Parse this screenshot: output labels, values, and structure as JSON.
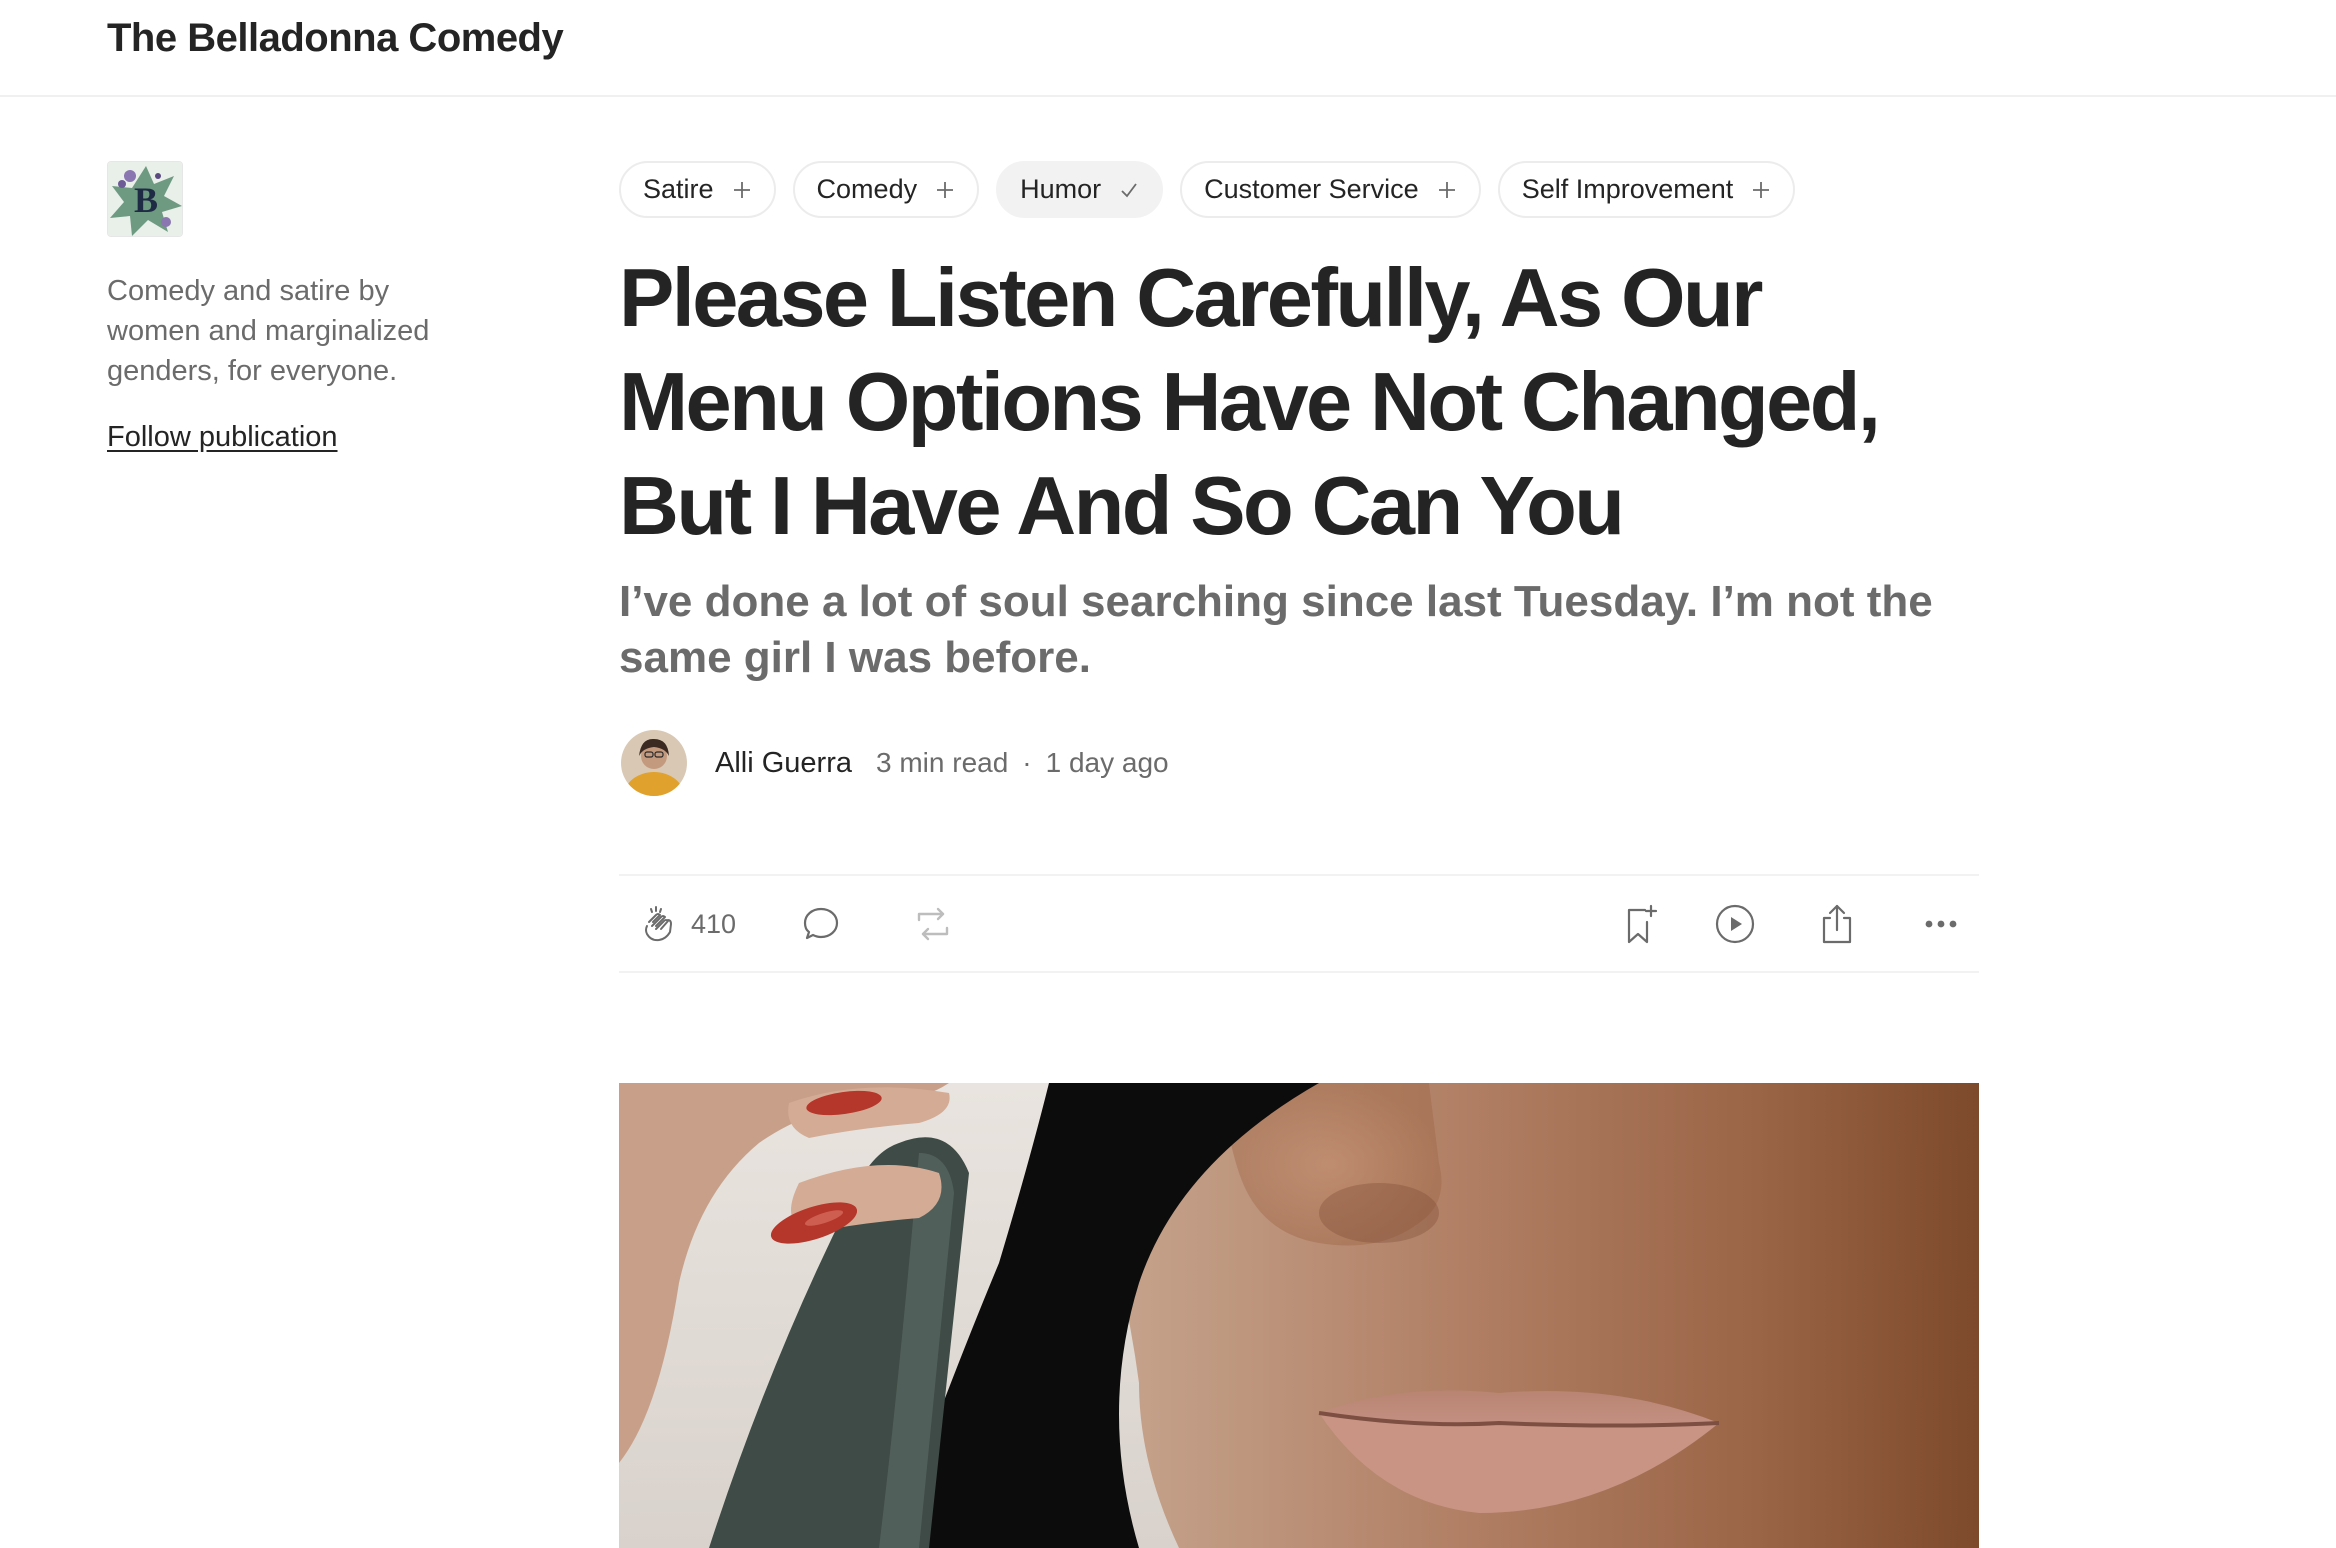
{
  "header": {
    "publication_title": "The Belladonna Comedy"
  },
  "sidebar": {
    "logo_icon": "publication-logo-b",
    "description": "Comedy and satire by women and marginalized genders, for everyone.",
    "follow_label": "Follow publication"
  },
  "tags": [
    {
      "label": "Satire",
      "state": "add"
    },
    {
      "label": "Comedy",
      "state": "add"
    },
    {
      "label": "Humor",
      "state": "following"
    },
    {
      "label": "Customer Service",
      "state": "add"
    },
    {
      "label": "Self Improvement",
      "state": "add"
    }
  ],
  "article": {
    "title": "Please Listen Carefully, As Our Menu Options Have Not Changed, But I Have And So Can You",
    "subtitle": "I’ve done a lot of soul searching since last Tuesday. I’m not the same girl I was before.",
    "author": "Alli Guerra",
    "read_time": "3 min read",
    "separator": "·",
    "published": "1 day ago"
  },
  "actions": {
    "clap_count": "410",
    "icons": [
      "clap-icon",
      "comment-icon",
      "repost-icon",
      "bookmark-add-icon",
      "play-icon",
      "share-icon",
      "more-icon"
    ]
  },
  "colors": {
    "text": "#242424",
    "muted": "#6b6b6b",
    "divider": "#f2f2f2",
    "tag_selected_bg": "#f2f2f2"
  }
}
